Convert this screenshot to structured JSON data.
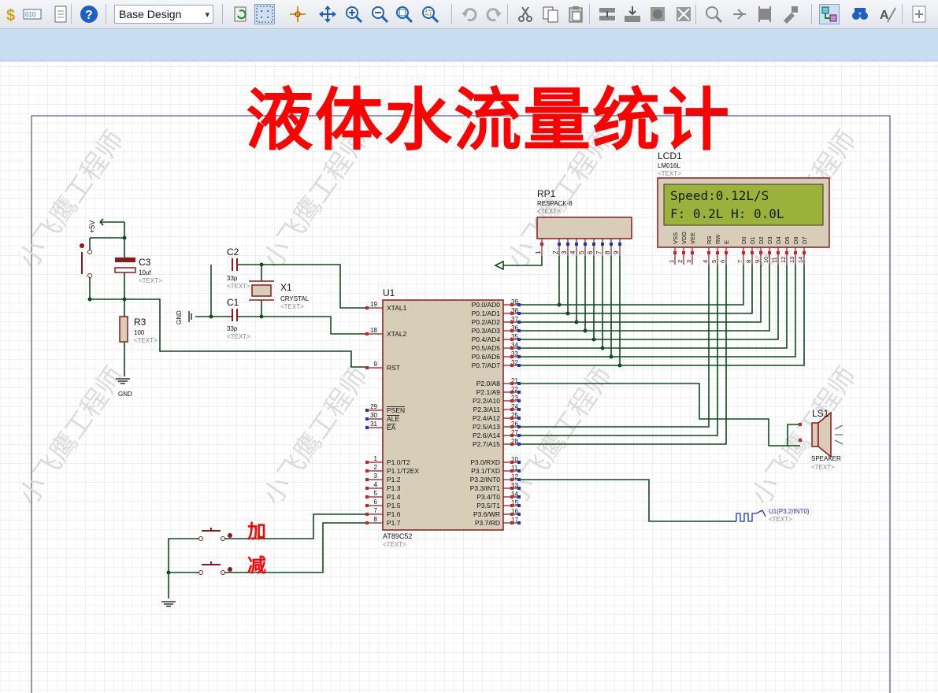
{
  "toolbar": {
    "design_select_value": "Base Design",
    "buttons": [
      "bill-of-materials",
      "netlist",
      "report",
      "help",
      "refresh",
      "grid",
      "origin",
      "pan",
      "zoom-in",
      "zoom-out",
      "zoom-all",
      "zoom-area",
      "undo",
      "redo",
      "cut",
      "copy",
      "paste",
      "block-copy",
      "block-move",
      "block-rotate",
      "block-delete",
      "pick-device",
      "make-device",
      "packaging",
      "decompose",
      "wire-autorouter",
      "search-tag",
      "property-assignment",
      "new-sheet"
    ]
  },
  "schematic": {
    "title": "液体水流量统计",
    "watermark": "小飞鹰工程师",
    "colors": {
      "wire": "#0d4d1c",
      "component": "#8b1a1a",
      "body": "#d8cdb8",
      "pin_red": "#cc2222",
      "pin_blue": "#1b33c8",
      "title": "#ff0000",
      "lcd_bg": "#9bb13a",
      "border": "#2b2b8a"
    },
    "mcu": {
      "ref": "U1",
      "part": "AT89C52",
      "text": "<TEXT>",
      "left_pins": [
        {
          "num": "19",
          "name": "XTAL1"
        },
        {
          "num": "18",
          "name": "XTAL2"
        },
        {
          "num": "9",
          "name": "RST"
        },
        {
          "num": "29",
          "name": "PSEN"
        },
        {
          "num": "30",
          "name": "ALE"
        },
        {
          "num": "31",
          "name": "EA"
        },
        {
          "num": "1",
          "name": "P1.0/T2"
        },
        {
          "num": "2",
          "name": "P1.1/T2EX"
        },
        {
          "num": "3",
          "name": "P1.2"
        },
        {
          "num": "4",
          "name": "P1.3"
        },
        {
          "num": "5",
          "name": "P1.4"
        },
        {
          "num": "6",
          "name": "P1.5"
        },
        {
          "num": "7",
          "name": "P1.6"
        },
        {
          "num": "8",
          "name": "P1.7"
        }
      ],
      "right_pins": [
        {
          "num": "39",
          "name": "P0.0/AD0"
        },
        {
          "num": "38",
          "name": "P0.1/AD1"
        },
        {
          "num": "37",
          "name": "P0.2/AD2"
        },
        {
          "num": "36",
          "name": "P0.3/AD3"
        },
        {
          "num": "35",
          "name": "P0.4/AD4"
        },
        {
          "num": "34",
          "name": "P0.5/AD5"
        },
        {
          "num": "33",
          "name": "P0.6/AD6"
        },
        {
          "num": "32",
          "name": "P0.7/AD7"
        },
        {
          "num": "21",
          "name": "P2.0/A8"
        },
        {
          "num": "22",
          "name": "P2.1/A9"
        },
        {
          "num": "23",
          "name": "P2.2/A10"
        },
        {
          "num": "24",
          "name": "P2.3/A11"
        },
        {
          "num": "25",
          "name": "P2.4/A12"
        },
        {
          "num": "26",
          "name": "P2.5/A13"
        },
        {
          "num": "27",
          "name": "P2.6/A14"
        },
        {
          "num": "28",
          "name": "P2.7/A15"
        },
        {
          "num": "10",
          "name": "P3.0/RXD"
        },
        {
          "num": "11",
          "name": "P3.1/TXD"
        },
        {
          "num": "12",
          "name": "P3.2/INT0"
        },
        {
          "num": "13",
          "name": "P3.3/INT1"
        },
        {
          "num": "14",
          "name": "P3.4/T0"
        },
        {
          "num": "15",
          "name": "P3.5/T1"
        },
        {
          "num": "16",
          "name": "P3.6/WR"
        },
        {
          "num": "17",
          "name": "P3.7/RD"
        }
      ]
    },
    "lcd": {
      "ref": "LCD1",
      "part": "LM016L",
      "text": "<TEXT>",
      "line1": "Speed:0.12L/S",
      "line2": "F: 0.2L  H: 0.0L",
      "pin_names": [
        "VSS",
        "VDD",
        "VEE",
        "RS",
        "RW",
        "E",
        "D0",
        "D1",
        "D2",
        "D3",
        "D4",
        "D5",
        "D6",
        "D7"
      ],
      "pin_nums": [
        "1",
        "2",
        "3",
        "4",
        "5",
        "6",
        "7",
        "8",
        "9",
        "10",
        "11",
        "12",
        "13",
        "14"
      ]
    },
    "rp1": {
      "ref": "RP1",
      "part": "RESPACK-8",
      "text": "<TEXT>",
      "pins": [
        "1",
        "2",
        "3",
        "4",
        "5",
        "6",
        "7",
        "8",
        "9"
      ]
    },
    "c1": {
      "ref": "C1",
      "value": "33p",
      "text": "<TEXT>"
    },
    "c2": {
      "ref": "C2",
      "value": "33p",
      "text": "<TEXT>"
    },
    "c3": {
      "ref": "C3",
      "value": "10uf",
      "text": "<TEXT>"
    },
    "x1": {
      "ref": "X1",
      "value": "CRYSTAL",
      "text": "<TEXT>"
    },
    "r3": {
      "ref": "R3",
      "value": "100",
      "text": "<TEXT>"
    },
    "ls1": {
      "ref": "LS1",
      "part": "SPEAKER",
      "text": "<TEXT>"
    },
    "power_label": "+5V",
    "gnd_label": "GND",
    "gnd2_label": "GND",
    "button_add_label": "加",
    "button_sub_label": "减",
    "generator": {
      "label": "U1(P3.2/INT0)",
      "text": "<TEXT>"
    }
  }
}
